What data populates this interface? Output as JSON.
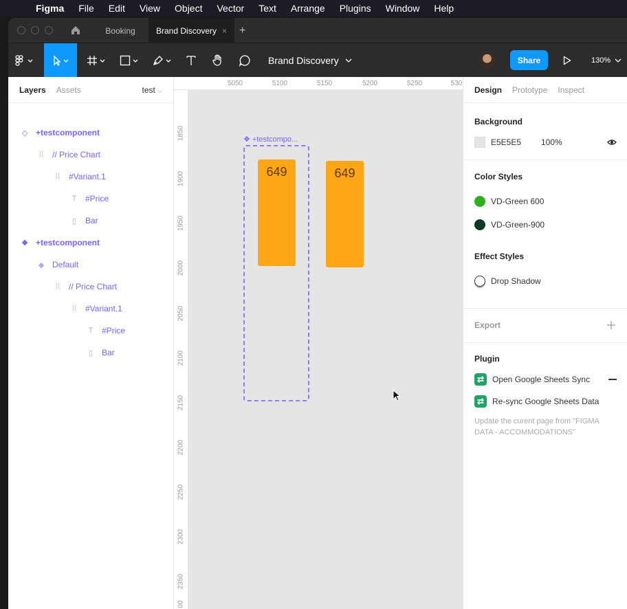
{
  "menubar": {
    "app": "Figma",
    "items": [
      "File",
      "Edit",
      "View",
      "Object",
      "Vector",
      "Text",
      "Arrange",
      "Plugins",
      "Window",
      "Help"
    ]
  },
  "tabs": {
    "inactive": "Booking",
    "active": "Brand Discovery",
    "close": "×",
    "add": "+"
  },
  "toolbar": {
    "doc_name": "Brand Discovery",
    "share_label": "Share",
    "zoom": "130%"
  },
  "left_panel": {
    "tab_layers": "Layers",
    "tab_assets": "Assets",
    "page": "test",
    "layers": [
      {
        "label": "+testcomponent",
        "icon": "component-outline-icon"
      },
      {
        "label": "// Price Chart",
        "icon": "frame-dotted-icon"
      },
      {
        "label": "#Variant.1",
        "icon": "frame-dotted-icon"
      },
      {
        "label": "#Price",
        "icon": "text-icon"
      },
      {
        "label": "Bar",
        "icon": "rectangle-icon"
      },
      {
        "label": "+testcomponent",
        "icon": "component-set-icon"
      },
      {
        "label": "Default",
        "icon": "variant-icon"
      },
      {
        "label": "// Price Chart",
        "icon": "frame-dotted-icon"
      },
      {
        "label": "#Variant.1",
        "icon": "frame-dotted-icon"
      },
      {
        "label": "#Price",
        "icon": "text-icon"
      },
      {
        "label": "Bar",
        "icon": "rectangle-icon"
      }
    ]
  },
  "rulers": {
    "top": [
      "5050",
      "5100",
      "5150",
      "5200",
      "5250",
      "530"
    ],
    "left": [
      "1850",
      "1900",
      "1950",
      "2000",
      "2050",
      "2100",
      "2150",
      "2200",
      "2250",
      "2300",
      "2350",
      "00"
    ]
  },
  "canvas": {
    "component_label": "+testcompo...",
    "bar1_value": "649",
    "bar2_value": "649",
    "bar_color": "#FFA617",
    "background": "#E5E5E5"
  },
  "right_panel": {
    "tab_design": "Design",
    "tab_prototype": "Prototype",
    "tab_inspect": "Inspect",
    "background_title": "Background",
    "background_hex": "E5E5E5",
    "background_opacity": "100%",
    "color_styles_title": "Color Styles",
    "color_styles": [
      {
        "name": "VD-Green 600",
        "color": "#2fb11f"
      },
      {
        "name": "VD-Green-900",
        "color": "#0b3b20"
      }
    ],
    "effect_styles_title": "Effect Styles",
    "effect_style": "Drop Shadow",
    "export_title": "Export",
    "plugin_title": "Plugin",
    "plugins": [
      "Open Google Sheets Sync",
      "Re-sync Google Sheets Data"
    ],
    "plugin_desc": "Update the curent page from \"FIGMA DATA - ACCOMMODATIONS\""
  }
}
